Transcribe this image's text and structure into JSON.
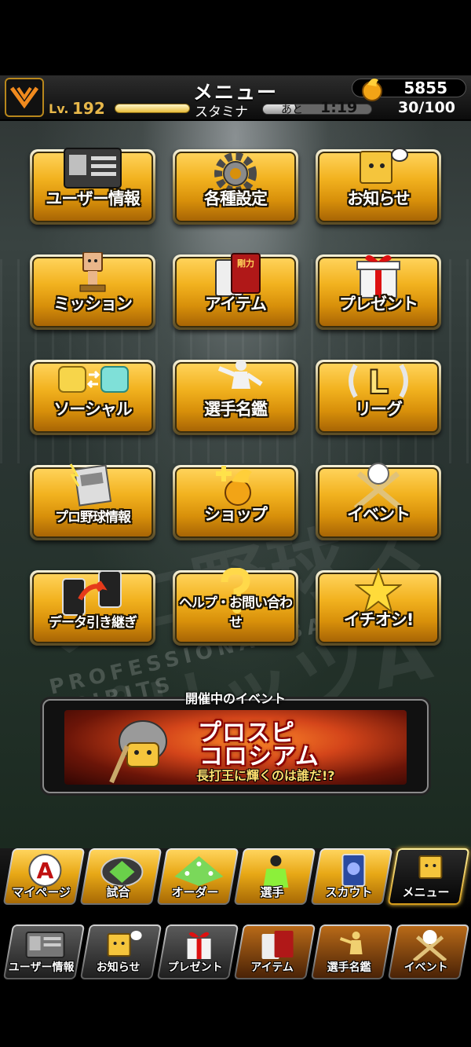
{
  "header": {
    "title": "メニュー",
    "coins": "5855",
    "level_label": "Lv.",
    "level": "192",
    "stamina_label": "スタミナ",
    "stamina_fill_fraction": 0.3,
    "time_left_label": "あと",
    "time_left": "1:19",
    "stamina_count": "30/100"
  },
  "menu": {
    "user_info": "ユーザー情報",
    "settings": "各種設定",
    "news": "お知らせ",
    "mission": "ミッション",
    "item": "アイテム",
    "present": "プレゼント",
    "social": "ソーシャル",
    "player_book": "選手名鑑",
    "league": "リーグ",
    "pro_baseball_info": "プロ野球情報",
    "shop": "ショップ",
    "event": "イベント",
    "data_transfer": "データ引き継ぎ",
    "help": "ヘルプ・お問い合わせ",
    "recommend": "イチオシ!"
  },
  "icons": {
    "league_letter": "L",
    "item_card_text": "剛力",
    "ball_letter": "A"
  },
  "event": {
    "heading": "開催中のイベント",
    "banner_title_1": "プロスピ",
    "banner_title_2": "コロシアム",
    "banner_subtitle": "長打王に輝くのは誰だ!?"
  },
  "background": {
    "word": "プロ野球スピリッツA",
    "sub": "PROFESSIONAL BASEBALL SPIRITS"
  },
  "nav": {
    "mypage": "マイページ",
    "game": "試合",
    "order": "オーダー",
    "player": "選手",
    "scout": "スカウト",
    "menu": "メニュー"
  },
  "shortcuts": {
    "user_info": "ユーザー情報",
    "news": "お知らせ",
    "present": "プレゼント",
    "item": "アイテム",
    "player_book": "選手名鑑",
    "event": "イベント"
  },
  "colors": {
    "gold": "#f2b21f",
    "dark": "#1b1200",
    "accent": "#e8b84a"
  }
}
